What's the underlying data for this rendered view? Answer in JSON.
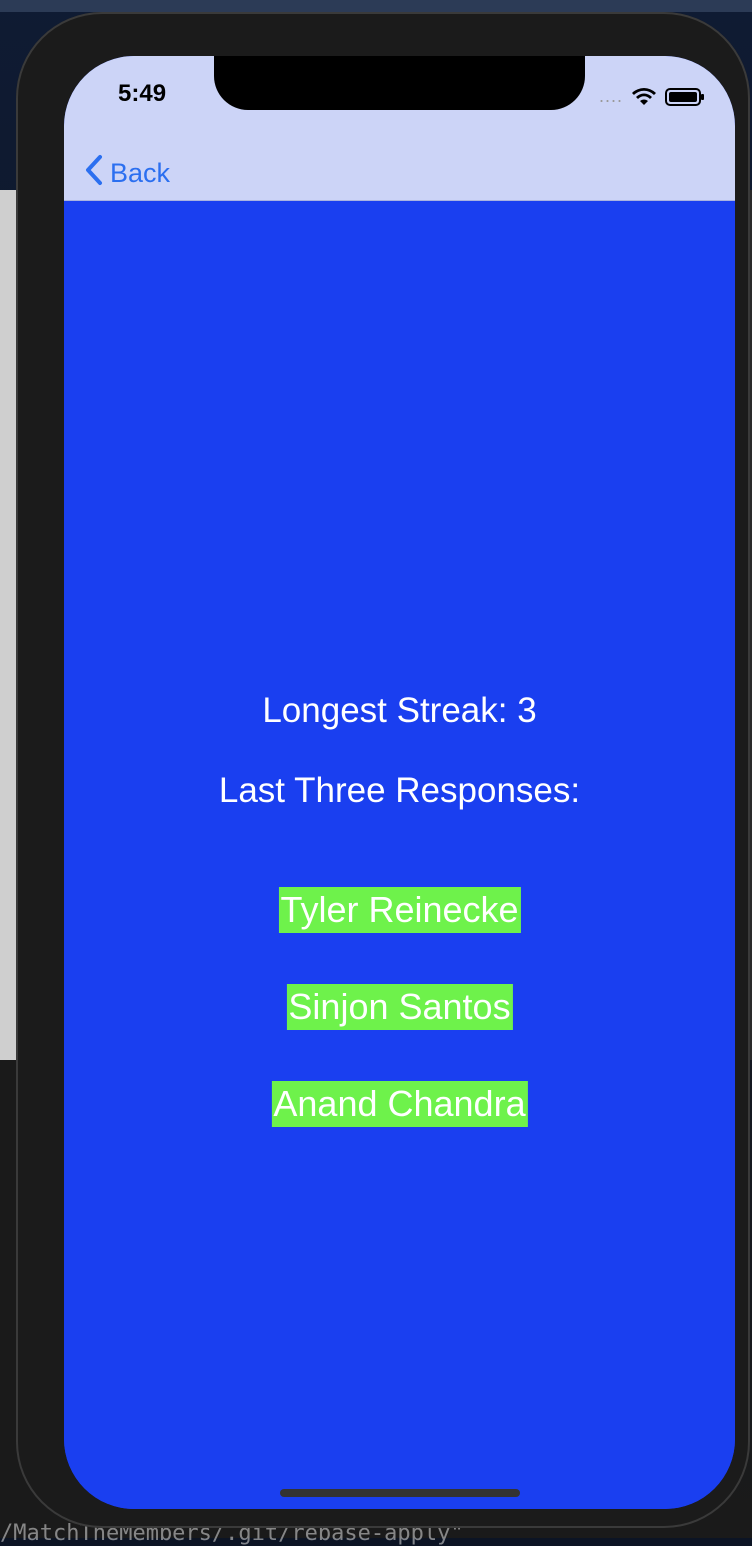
{
  "status_bar": {
    "time": "5:49",
    "signal": "....",
    "wifi_icon": "wifi-icon",
    "battery_icon": "battery-icon"
  },
  "nav": {
    "back_label": "Back",
    "back_icon": "chevron-left-icon",
    "accent_color": "#2b6ff0"
  },
  "main": {
    "background_color": "#1a3ff0",
    "longest_streak_label": "Longest Streak: 3",
    "last_three_label": "Last Three Responses:",
    "responses": [
      "Tyler Reinecke",
      "Sinjon Santos",
      "Anand Chandra"
    ],
    "response_highlight_color": "#6ef24b"
  },
  "background_fragments": {
    "code_line": "/MatchTheMembers/.git/rebase-apply\""
  }
}
